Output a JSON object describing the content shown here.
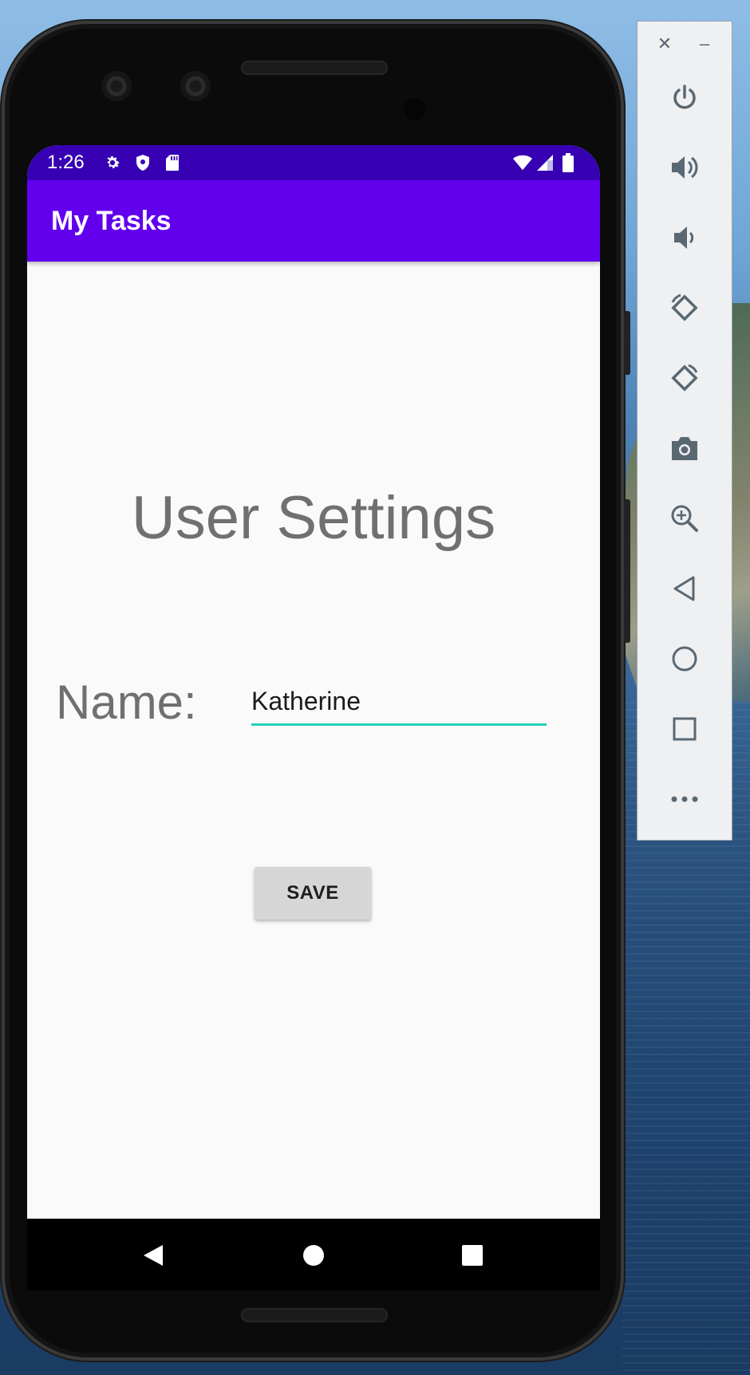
{
  "status_bar": {
    "time": "1:26",
    "icons": [
      "settings-icon",
      "shield-icon",
      "sd-card-icon",
      "wifi-icon",
      "signal-icon",
      "battery-icon"
    ]
  },
  "app_bar": {
    "title": "My Tasks",
    "color": "#6200ee"
  },
  "content": {
    "heading": "User Settings",
    "name_label": "Name:",
    "name_value": "Katherine",
    "save_label": "SAVE"
  },
  "nav_bar": {
    "buttons": [
      "back-icon",
      "home-icon",
      "recents-icon"
    ]
  },
  "emulator_panel": {
    "window_controls": [
      "close-icon",
      "minimize-icon"
    ],
    "buttons": [
      "power-icon",
      "volume-up-icon",
      "volume-down-icon",
      "rotate-left-icon",
      "rotate-right-icon",
      "camera-icon",
      "zoom-icon",
      "back-icon",
      "home-icon",
      "overview-icon",
      "more-icon"
    ]
  },
  "colors": {
    "status_bar": "#3700b3",
    "accent": "#1fd1b8",
    "text_gray": "#707070"
  }
}
